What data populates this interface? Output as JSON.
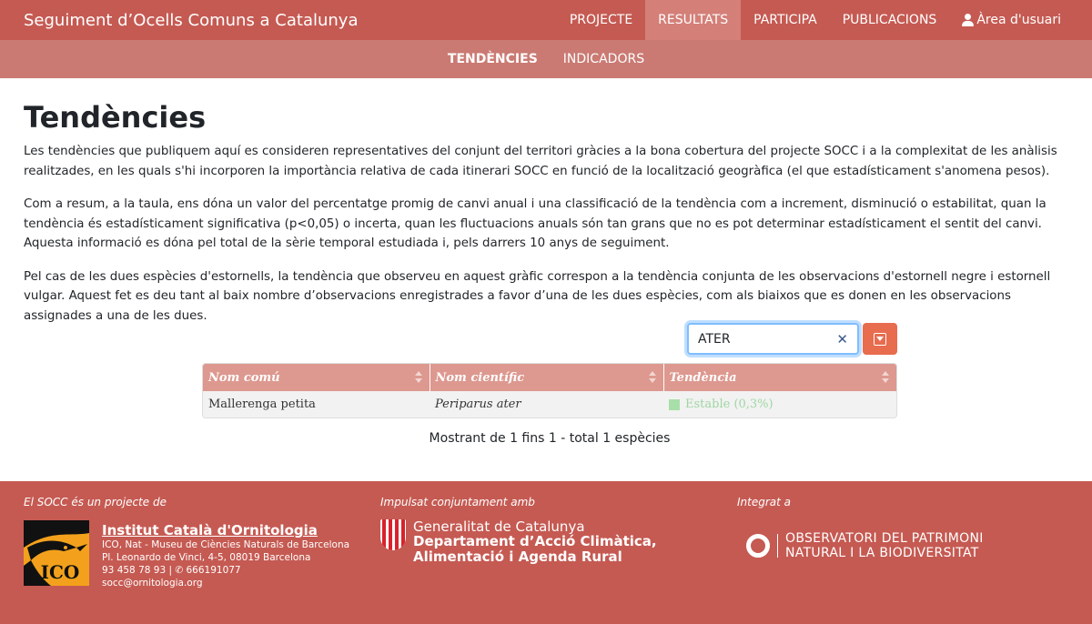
{
  "header": {
    "brand": "Seguiment d’Ocells Comuns a Catalunya",
    "nav": [
      {
        "label": "PROJECTE",
        "active": false
      },
      {
        "label": "RESULTATS",
        "active": true
      },
      {
        "label": "PARTICIPA",
        "active": false
      },
      {
        "label": "PUBLICACIONS",
        "active": false
      }
    ],
    "user_area": "Àrea d'usuari"
  },
  "subnav": [
    {
      "label": "TENDÈNCIES",
      "active": true
    },
    {
      "label": "INDICADORS",
      "active": false
    }
  ],
  "main": {
    "title": "Tendències",
    "paragraphs": [
      "Les tendències que publiquem aquí es consideren representatives del conjunt del territori gràcies a la bona cobertura del projecte SOCC i a la complexitat de les anàlisis realitzades, en les quals s'hi incorporen la importància relativa de cada itinerari SOCC en funció de la localització geogràfica (el que estadísticament s'anomena pesos).",
      "Com a resum, a la taula, ens dóna un valor del percentatge promig de canvi anual i una classificació de la tendència com a increment, disminució o estabilitat, quan la tendència és estadísticament significativa (p<0,05) o incerta, quan les fluctuacions anuals són tan grans que no es pot determinar estadísticament el sentit del canvi. Aquesta informació es dóna pel total de la sèrie temporal estudiada i, pels darrers 10 anys de seguiment.",
      "Pel cas de les dues espècies d'estornells, la tendència que observeu en aquest gràfic correspon a la tendència conjunta de les observacions d'estornell negre i estornell vulgar. Aquest fet es deu tant al baix nombre d’observacions enregistrades a favor d’una de les dues espècies, com als biaixos que es donen en les observacions assignades a una de les dues."
    ],
    "search_value": "ATER",
    "table": {
      "columns": [
        "Nom comú",
        "Nom científic",
        "Tendència"
      ],
      "rows": [
        {
          "common": "Mallerenga petita",
          "scientific": "Periparus ater",
          "trend": "Estable (0,3%)"
        }
      ]
    },
    "info": "Mostrant de 1 fins 1 - total 1 espècies"
  },
  "footer": {
    "col1_caption": "El SOCC és un projecte de",
    "ico_logo_text": "ICO",
    "ico_name": "Institut Català d'Ornitologia",
    "ico_lines": [
      "ICO, Nat - Museu de Ciències Naturals de Barcelona",
      "Pl. Leonardo de Vinci, 4-5, 08019 Barcelona",
      "93 458 78 93  |  ✆ 666191077",
      "socc@ornitologia.org"
    ],
    "col2_caption": "Impulsat conjuntament amb",
    "gen_line1": "Generalitat de Catalunya",
    "gen_line2": "Departament d’Acció Climàtica,",
    "gen_line3": "Alimentació i Agenda Rural",
    "col3_caption": "Integrat a",
    "obs_line1": "OBSERVATORI DEL PATRIMONI",
    "obs_line2": "NATURAL I LA BIODIVERSITAT"
  },
  "colors": {
    "primary": "#c55a52",
    "subnav": "#ca7a73",
    "table_header": "#dd988f",
    "trend_stable": "#a8dfa9",
    "dropdown": "#e86c4e"
  }
}
